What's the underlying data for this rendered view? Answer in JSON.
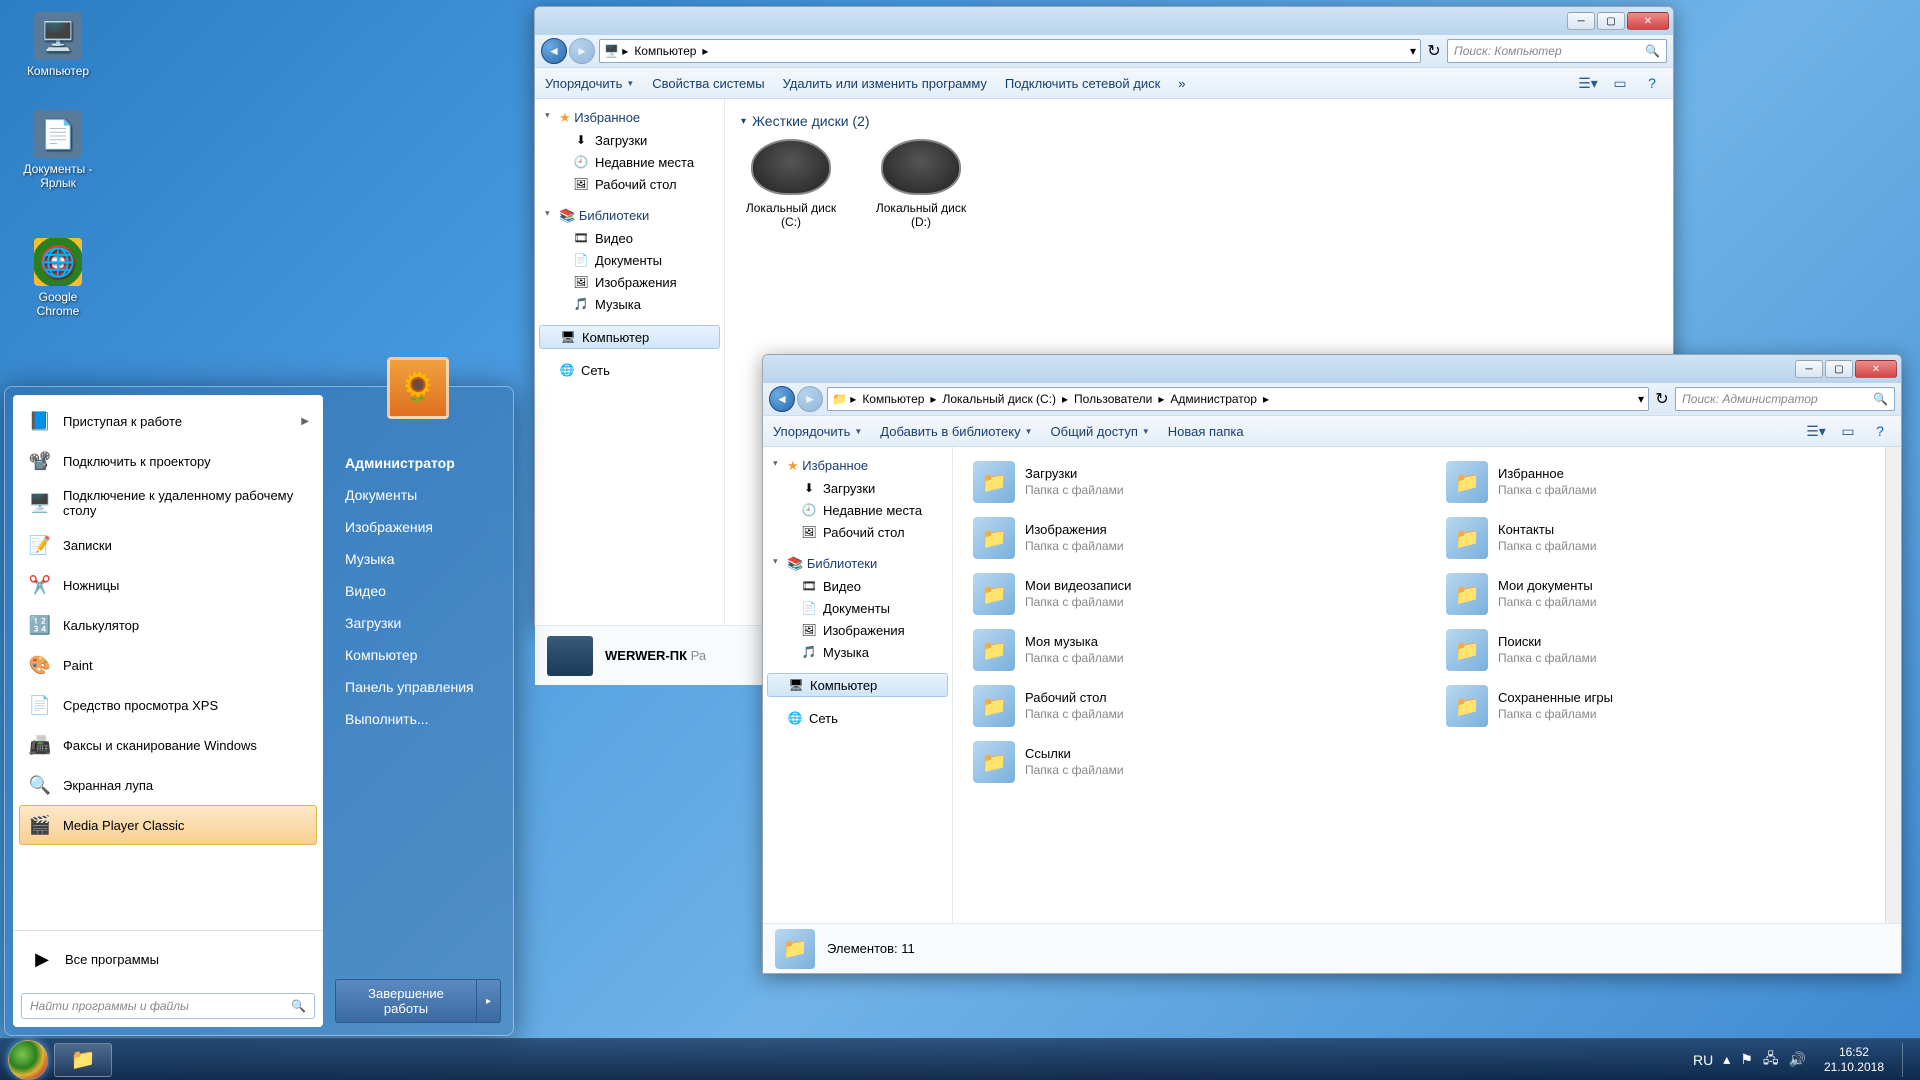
{
  "desktop": {
    "icons": [
      {
        "label": "Компьютер",
        "glyph": "🖥️"
      },
      {
        "label": "Документы - Ярлык",
        "glyph": "📄"
      },
      {
        "label": "Google Chrome",
        "glyph": "🌐"
      }
    ]
  },
  "window1": {
    "breadcrumb": [
      "Компьютер"
    ],
    "search_placeholder": "Поиск: Компьютер",
    "toolbar": {
      "organize": "Упорядочить",
      "sysprop": "Свойства системы",
      "uninstall": "Удалить или изменить программу",
      "mapdrive": "Подключить сетевой диск",
      "more": "»"
    },
    "sidebar": {
      "fav": "Избранное",
      "fav_items": [
        "Загрузки",
        "Недавние места",
        "Рабочий стол"
      ],
      "lib": "Библиотеки",
      "lib_items": [
        "Видео",
        "Документы",
        "Изображения",
        "Музыка"
      ],
      "computer": "Компьютер",
      "network": "Сеть"
    },
    "group": "Жесткие диски (2)",
    "drives": [
      "Локальный диск (C:)",
      "Локальный диск (D:)"
    ],
    "details": {
      "name": "WERWER-ПК",
      "sub": "Ра"
    }
  },
  "window2": {
    "breadcrumb": [
      "Компьютер",
      "Локальный диск (C:)",
      "Пользователи",
      "Администратор"
    ],
    "search_placeholder": "Поиск: Администратор",
    "toolbar": {
      "organize": "Упорядочить",
      "addlib": "Добавить в библиотеку",
      "share": "Общий доступ",
      "newfolder": "Новая папка"
    },
    "sidebar": {
      "fav": "Избранное",
      "fav_items": [
        "Загрузки",
        "Недавние места",
        "Рабочий стол"
      ],
      "lib": "Библиотеки",
      "lib_items": [
        "Видео",
        "Документы",
        "Изображения",
        "Музыка"
      ],
      "computer": "Компьютер",
      "network": "Сеть"
    },
    "folders": [
      {
        "name": "Загрузки",
        "sub": "Папка с файлами"
      },
      {
        "name": "Избранное",
        "sub": "Папка с файлами"
      },
      {
        "name": "Изображения",
        "sub": "Папка с файлами"
      },
      {
        "name": "Контакты",
        "sub": "Папка с файлами"
      },
      {
        "name": "Мои видеозаписи",
        "sub": "Папка с файлами"
      },
      {
        "name": "Мои документы",
        "sub": "Папка с файлами"
      },
      {
        "name": "Моя музыка",
        "sub": "Папка с файлами"
      },
      {
        "name": "Поиски",
        "sub": "Папка с файлами"
      },
      {
        "name": "Рабочий стол",
        "sub": "Папка с файлами"
      },
      {
        "name": "Сохраненные игры",
        "sub": "Папка с файлами"
      },
      {
        "name": "Ссылки",
        "sub": "Папка с файлами"
      }
    ],
    "status": "Элементов: 11"
  },
  "startmenu": {
    "programs": [
      {
        "label": "Приступая к работе",
        "glyph": "📘",
        "arrow": true
      },
      {
        "label": "Подключить к проектору",
        "glyph": "📽️"
      },
      {
        "label": "Подключение к удаленному рабочему столу",
        "glyph": "🖥️"
      },
      {
        "label": "Записки",
        "glyph": "📝"
      },
      {
        "label": "Ножницы",
        "glyph": "✂️"
      },
      {
        "label": "Калькулятор",
        "glyph": "🔢"
      },
      {
        "label": "Paint",
        "glyph": "🎨"
      },
      {
        "label": "Средство просмотра XPS",
        "glyph": "📄"
      },
      {
        "label": "Факсы и сканирование Windows",
        "glyph": "📠"
      },
      {
        "label": "Экранная лупа",
        "glyph": "🔍"
      },
      {
        "label": "Media Player Classic",
        "glyph": "🎬",
        "hover": true
      }
    ],
    "allprograms": "Все программы",
    "search_placeholder": "Найти программы и файлы",
    "user": "Администратор",
    "links": [
      "Документы",
      "Изображения",
      "Музыка",
      "Видео",
      "Загрузки",
      "Компьютер",
      "Панель управления",
      "Выполнить..."
    ],
    "shutdown": "Завершение работы"
  },
  "taskbar": {
    "lang": "RU",
    "time": "16:52",
    "date": "21.10.2018"
  }
}
